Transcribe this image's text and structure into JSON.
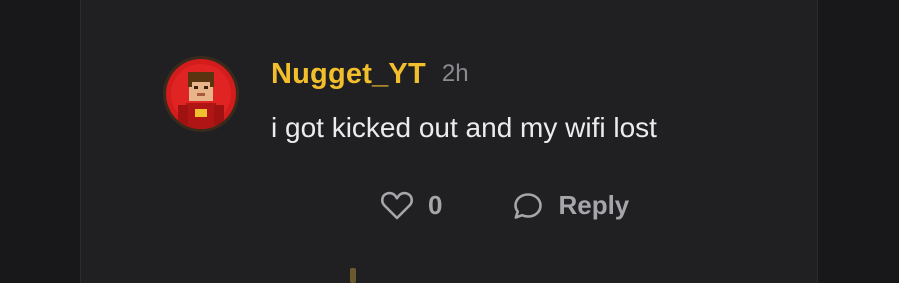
{
  "comment": {
    "author": "Nugget_YT",
    "time": "2h",
    "text": "i got kicked out and my wifi lost",
    "like_count": "0",
    "reply_label": "Reply"
  },
  "icons": {
    "like": "heart-icon",
    "reply": "speech-bubble-icon"
  },
  "colors": {
    "author": "#f2be2c",
    "background": "#202023",
    "text": "#ececef",
    "muted": "#a6a6aa"
  }
}
